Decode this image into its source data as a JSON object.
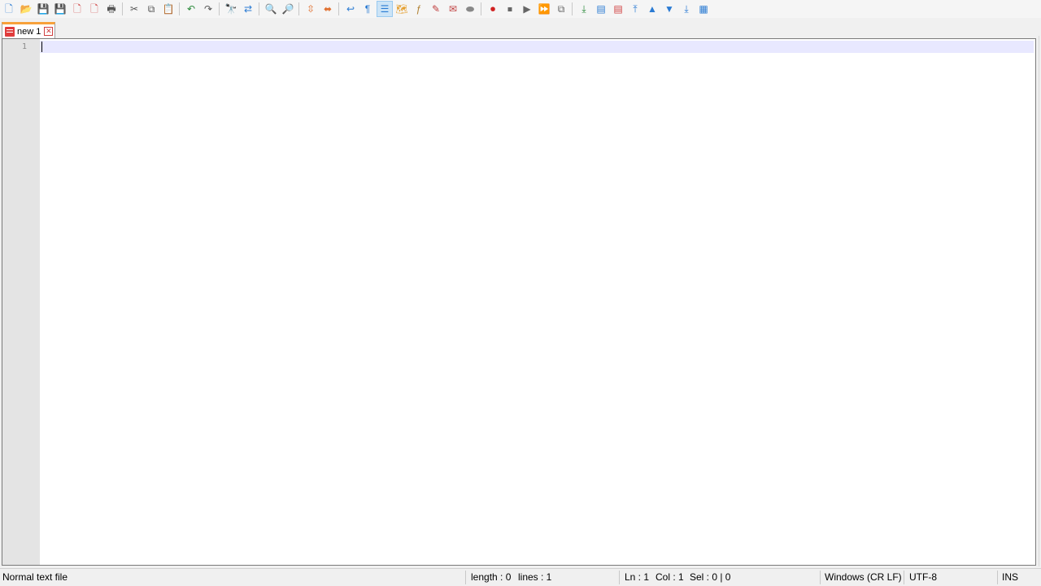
{
  "toolbar": {
    "buttons": [
      {
        "name": "new-file-icon",
        "glyph": "🗋",
        "color": "#2b7bd3"
      },
      {
        "name": "open-file-icon",
        "glyph": "📂",
        "color": "#e5b33b"
      },
      {
        "name": "save-icon",
        "glyph": "💾",
        "color": "#3a6fc4"
      },
      {
        "name": "save-all-icon",
        "glyph": "💾",
        "color": "#3a6fc4"
      },
      {
        "name": "close-file-icon",
        "glyph": "🗋",
        "color": "#d04040"
      },
      {
        "name": "close-all-icon",
        "glyph": "🗋",
        "color": "#d04040"
      },
      {
        "name": "print-icon",
        "glyph": "🖶",
        "color": "#555555"
      },
      {
        "sep": true
      },
      {
        "name": "cut-icon",
        "glyph": "✂",
        "color": "#555555"
      },
      {
        "name": "copy-icon",
        "glyph": "⧉",
        "color": "#555555"
      },
      {
        "name": "paste-icon",
        "glyph": "📋",
        "color": "#8a6a3a"
      },
      {
        "sep": true
      },
      {
        "name": "undo-icon",
        "glyph": "↶",
        "color": "#2a8a3a"
      },
      {
        "name": "redo-icon",
        "glyph": "↷",
        "color": "#555555"
      },
      {
        "sep": true
      },
      {
        "name": "find-icon",
        "glyph": "🔭",
        "color": "#333333"
      },
      {
        "name": "replace-icon",
        "glyph": "⇄",
        "color": "#2b7bd3"
      },
      {
        "sep": true
      },
      {
        "name": "zoom-in-icon",
        "glyph": "🔍",
        "color": "#2b7bd3"
      },
      {
        "name": "zoom-out-icon",
        "glyph": "🔎",
        "color": "#c04040"
      },
      {
        "sep": true
      },
      {
        "name": "sync-vertical-icon",
        "glyph": "⇳",
        "color": "#e07030"
      },
      {
        "name": "sync-horizontal-icon",
        "glyph": "⬌",
        "color": "#e07030"
      },
      {
        "sep": true
      },
      {
        "name": "word-wrap-icon",
        "glyph": "↩",
        "color": "#2b7bd3"
      },
      {
        "name": "show-all-characters-icon",
        "glyph": "¶",
        "color": "#2b7bd3"
      },
      {
        "name": "indent-guide-icon",
        "glyph": "☰",
        "color": "#2b7bd3",
        "active": true
      },
      {
        "name": "document-map-icon",
        "glyph": "🗺",
        "color": "#e5a030"
      },
      {
        "name": "function-list-icon",
        "glyph": "ƒ",
        "color": "#b08030"
      },
      {
        "name": "folder-as-workspace-icon",
        "glyph": "✎",
        "color": "#c04040"
      },
      {
        "name": "monitoring-icon",
        "glyph": "✉",
        "color": "#c04040"
      },
      {
        "name": "user-lang-icon",
        "glyph": "⬬",
        "color": "#888888"
      },
      {
        "sep": true
      },
      {
        "name": "macro-record-icon",
        "glyph": "⏺",
        "color": "#d02020"
      },
      {
        "name": "macro-stop-icon",
        "glyph": "⏹",
        "color": "#666666"
      },
      {
        "name": "macro-play-icon",
        "glyph": "▶",
        "color": "#666666"
      },
      {
        "name": "macro-run-multiple-icon",
        "glyph": "⏩",
        "color": "#2b7bd3"
      },
      {
        "name": "macro-save-icon",
        "glyph": "⧉",
        "color": "#666666"
      },
      {
        "sep": true
      },
      {
        "name": "download-icon",
        "glyph": "⤓",
        "color": "#2a8a3a"
      },
      {
        "name": "compare-icon",
        "glyph": "▤",
        "color": "#2b7bd3"
      },
      {
        "name": "clear-compare-icon",
        "glyph": "▤",
        "color": "#d04040"
      },
      {
        "name": "first-diff-icon",
        "glyph": "⤒",
        "color": "#2b7bd3"
      },
      {
        "name": "previous-diff-icon",
        "glyph": "▲",
        "color": "#2b7bd3"
      },
      {
        "name": "next-diff-icon",
        "glyph": "▼",
        "color": "#2b7bd3"
      },
      {
        "name": "last-diff-icon",
        "glyph": "⤓",
        "color": "#2b7bd3"
      },
      {
        "name": "navigation-bar-icon",
        "glyph": "▦",
        "color": "#2b7bd3"
      }
    ]
  },
  "tabs": [
    {
      "label": "new 1",
      "active": true
    }
  ],
  "editor": {
    "lines": [
      "1"
    ]
  },
  "status": {
    "file_type": "Normal text file",
    "length": "length : 0",
    "lines": "lines : 1",
    "ln": "Ln : 1",
    "col": "Col : 1",
    "sel": "Sel : 0 | 0",
    "eol": "Windows (CR LF)",
    "encoding": "UTF-8",
    "mode": "INS"
  },
  "colors": {
    "tab_accent": "#f7a13a",
    "current_line": "#e8e8ff",
    "gutter": "#e4e4e4"
  }
}
